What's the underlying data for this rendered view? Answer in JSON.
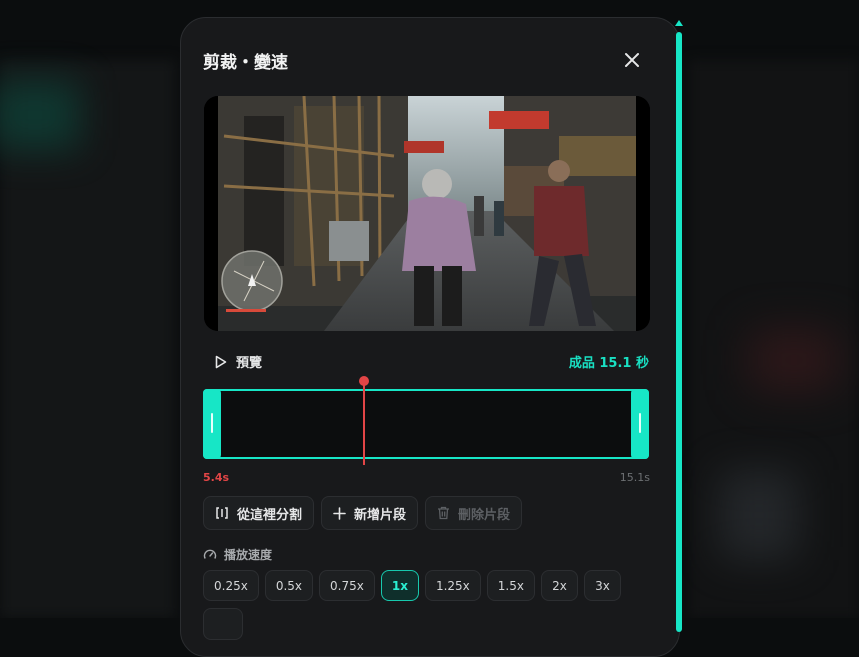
{
  "dialog": {
    "title": "剪裁・變速"
  },
  "preview": {
    "label": "預覽",
    "output_duration": "成品 15.1 秒"
  },
  "timeline": {
    "start_label": "5.4s",
    "end_label": "15.1s",
    "playhead_fraction": 0.36
  },
  "actions": {
    "split": "從這裡分割",
    "add_segment": "新增片段",
    "delete_segment": "刪除片段"
  },
  "speed": {
    "label": "播放速度",
    "options": [
      "0.25x",
      "0.5x",
      "0.75x",
      "1x",
      "1.25x",
      "1.5x",
      "2x",
      "3x"
    ],
    "selected": "1x"
  },
  "colors": {
    "accent": "#17e6c6",
    "playhead": "#e24546"
  },
  "icons": {
    "close": "close-icon",
    "play": "play-icon",
    "split": "split-icon",
    "add": "plus-icon",
    "delete": "trash-icon",
    "speed": "speedometer-icon"
  }
}
